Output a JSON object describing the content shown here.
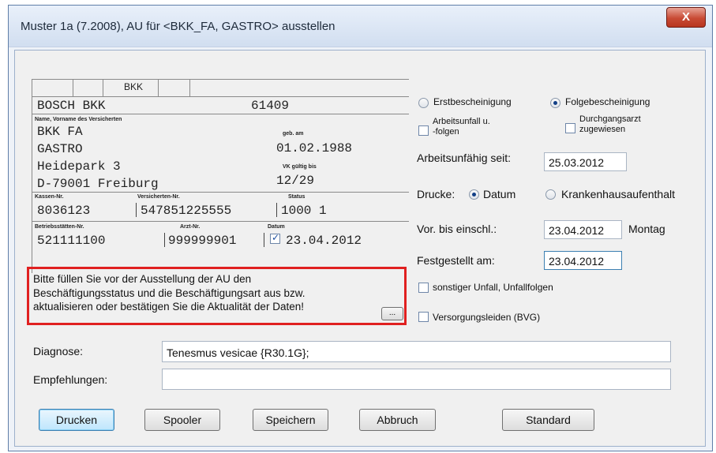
{
  "window": {
    "title": "Muster 1a (7.2008), AU für <BKK_FA, GASTRO> ausstellen",
    "close_label": "X"
  },
  "form": {
    "bkk_label": "BKK",
    "insurer_name": "BOSCH BKK",
    "insurer_number": "61409",
    "name_caption": "Name, Vorname des Versicherten",
    "geb_caption": "geb. am",
    "last_name": "BKK FA",
    "first_name": "GASTRO",
    "birth_date": "01.02.1988",
    "street": "Heidepark 3",
    "vk_caption": "VK gültig bis",
    "city": "D-79001 Freiburg",
    "vk_valid": "12/29",
    "kassen_caption": "Kassen-Nr.",
    "versicherten_caption": "Versicherten-Nr.",
    "status_caption": "Status",
    "kassen_nr": "8036123",
    "versicherten_nr": "547851225555",
    "status": "1000 1",
    "bs_caption": "Betriebsstätten-Nr.",
    "arzt_caption": "Arzt-Nr.",
    "datum_caption": "Datum",
    "bs_nr": "521111100",
    "arzt_nr": "999999901",
    "datum": "23.04.2012"
  },
  "warning": {
    "line1": "Bitte füllen Sie vor der Ausstellung der AU den",
    "line2": "Beschäftigungsstatus und die Beschäftigungsart aus bzw.",
    "line3": "aktualisieren oder bestätigen Sie die Aktualität der Daten!",
    "button": "..."
  },
  "right": {
    "erst": "Erstbescheinigung",
    "folge": "Folgebescheinigung",
    "arbeitsunfall_1": "Arbeitsunfall u.",
    "arbeitsunfall_2": "-folgen",
    "durchgang_1": "Durchgangsarzt",
    "durchgang_2": "zugewiesen",
    "au_seit_label": "Arbeitsunfähig seit:",
    "au_seit_value": "25.03.2012",
    "drucke_label": "Drucke:",
    "datum_option": "Datum",
    "kh_option": "Krankenhausaufenthalt",
    "vor_bis_label": "Vor. bis einschl.:",
    "vor_bis_value": "23.04.2012",
    "vor_bis_day": "Montag",
    "festgestellt_label": "Festgestellt am:",
    "festgestellt_value": "23.04.2012",
    "sonstiger": "sonstiger Unfall, Unfallfolgen",
    "versorgung": "Versorgungsleiden (BVG)"
  },
  "diagnose": {
    "label": "Diagnose:",
    "value": "Tenesmus vesicae {R30.1G};"
  },
  "empfehlungen": {
    "label": "Empfehlungen:",
    "value": ""
  },
  "buttons": {
    "drucken": "Drucken",
    "spooler": "Spooler",
    "speichern": "Speichern",
    "abbruch": "Abbruch",
    "standard": "Standard"
  }
}
